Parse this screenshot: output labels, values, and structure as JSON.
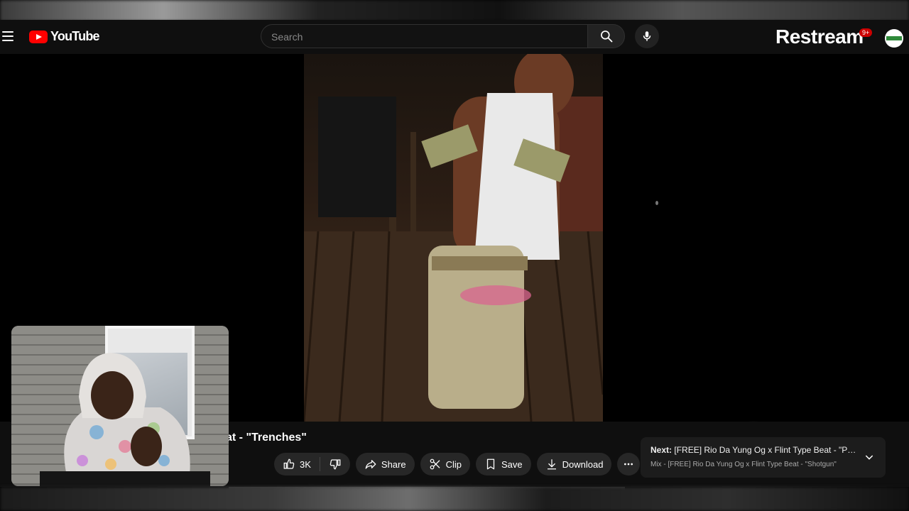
{
  "header": {
    "logo_text": "YouTube",
    "search_placeholder": "Search",
    "overlay_brand": "Restream",
    "notification_count": "9+"
  },
  "video": {
    "title_visible": "at - \"Trenches\""
  },
  "actions": {
    "like_count": "3K",
    "share_label": "Share",
    "clip_label": "Clip",
    "save_label": "Save",
    "download_label": "Download"
  },
  "next_up": {
    "prefix": "Next:",
    "title": "[FREE] Rio Da Yung Og x Flint Type Beat - \"Pu...",
    "subtitle": "Mix - [FREE] Rio Da Yung Og x Flint Type Beat - \"Shotgun\""
  },
  "colors": {
    "brand_red": "#ff0000",
    "header_bg": "#0f0f0f",
    "pill_bg": "#272727"
  },
  "icons": [
    "menu-icon",
    "youtube-logo-icon",
    "search-icon",
    "mic-icon",
    "thumbs-up-icon",
    "thumbs-down-icon",
    "share-icon",
    "scissors-icon",
    "bookmark-icon",
    "download-icon",
    "more-icon",
    "chevron-down-icon"
  ]
}
